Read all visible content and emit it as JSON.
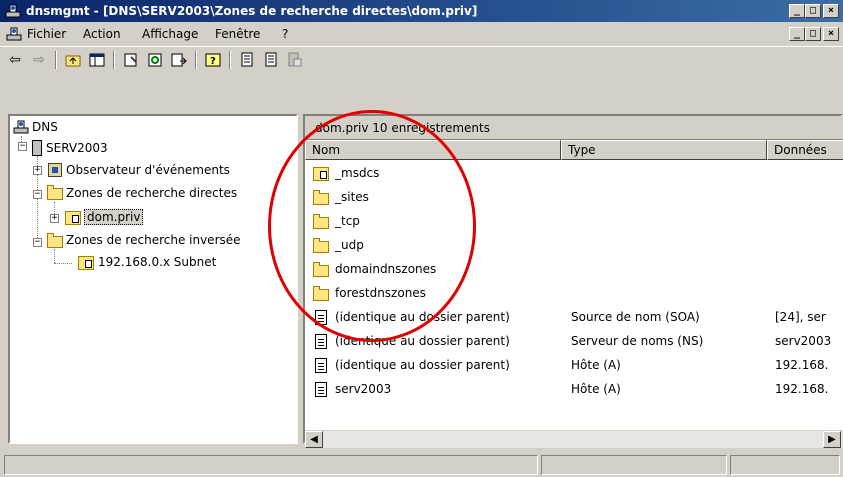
{
  "window": {
    "title": "dnsmgmt - [DNS\\SERV2003\\Zones de recherche directes\\dom.priv]",
    "buttons": [
      "minimize-button",
      "restore-button",
      "close-button"
    ]
  },
  "menu": {
    "items": [
      {
        "label": "Fichier"
      },
      {
        "label": "Action"
      },
      {
        "label": "Affichage"
      },
      {
        "label": "Fenêtre"
      },
      {
        "label": "?"
      }
    ]
  },
  "toolbar": {
    "icons": [
      "back-icon",
      "forward-icon",
      "up-folder-icon",
      "show-hide-tree-icon",
      "properties-icon",
      "refresh-icon",
      "export-list-icon",
      "help-icon",
      "record-icon",
      "record-icon",
      "server-icon"
    ]
  },
  "tree": {
    "root": {
      "label": "DNS"
    },
    "server": {
      "label": "SERV2003"
    },
    "event_viewer": {
      "label": "Observateur d'événements"
    },
    "forward_zones": {
      "label": "Zones de recherche directes"
    },
    "zone_dom_priv": {
      "label": "dom.priv"
    },
    "reverse_zones": {
      "label": "Zones de recherche inversée"
    },
    "subnet": {
      "label": "192.168.0.x Subnet"
    }
  },
  "right_pane": {
    "header": "dom.priv    10 enregistrements",
    "columns": [
      "Nom",
      "Type",
      "Données"
    ],
    "rows": [
      {
        "name": "_msdcs",
        "type": "",
        "data": "",
        "icon": "zone-folder-icon"
      },
      {
        "name": "_sites",
        "type": "",
        "data": "",
        "icon": "folder-icon"
      },
      {
        "name": "_tcp",
        "type": "",
        "data": "",
        "icon": "folder-icon"
      },
      {
        "name": "_udp",
        "type": "",
        "data": "",
        "icon": "folder-icon"
      },
      {
        "name": "domaindnszones",
        "type": "",
        "data": "",
        "icon": "folder-icon"
      },
      {
        "name": "forestdnszones",
        "type": "",
        "data": "",
        "icon": "folder-icon"
      },
      {
        "name": "(identique au dossier parent)",
        "type": "Source de nom (SOA)",
        "data": "[24], ser",
        "icon": "record-icon"
      },
      {
        "name": "(identique au dossier parent)",
        "type": "Serveur de noms (NS)",
        "data": "serv2003",
        "icon": "record-icon"
      },
      {
        "name": "(identique au dossier parent)",
        "type": "Hôte (A)",
        "data": "192.168.",
        "icon": "record-icon"
      },
      {
        "name": "serv2003",
        "type": "Hôte (A)",
        "data": "192.168.",
        "icon": "record-icon"
      }
    ]
  },
  "colors": {
    "titlebar_start": "#0a246a",
    "titlebar_end": "#3a6ea5",
    "annotation_circle": "#e00000",
    "face": "#d4d0c8"
  }
}
